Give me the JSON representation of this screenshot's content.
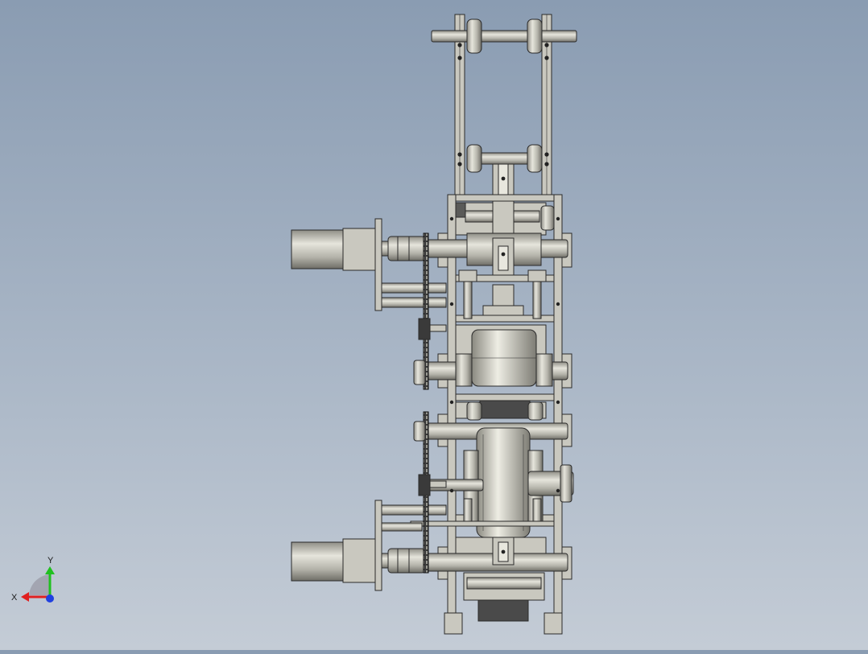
{
  "viewport": {
    "background_top": "#8a9cb2",
    "background_bottom": "#c4ccd6",
    "part_fill": "#c9c8bf",
    "part_edge": "#2a2a2a",
    "dark_fill": "#4a4a4a"
  },
  "triad": {
    "x_label": "X",
    "y_label": "Y",
    "x_color": "#e02020",
    "y_color": "#20c020",
    "z_color": "#2040e0"
  }
}
